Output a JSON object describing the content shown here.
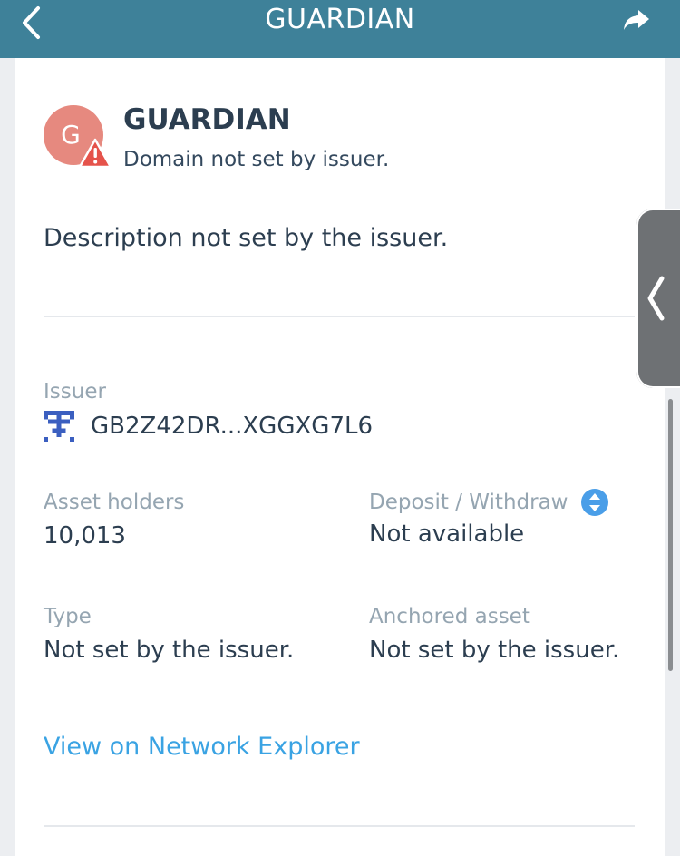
{
  "nav": {
    "title": "GUARDIAN",
    "back_icon": "chevron-left-icon",
    "share_icon": "share-arrow-icon"
  },
  "asset": {
    "avatar_letter": "G",
    "name": "GUARDIAN",
    "domain": "Domain not set by issuer.",
    "description": "Description not set by the issuer."
  },
  "details": {
    "issuer_label": "Issuer",
    "issuer_value": "GB2Z42DR...XGGXG7L6",
    "holders_label": "Asset holders",
    "holders_value": "10,013",
    "deposit_label": "Deposit / Withdraw",
    "deposit_value": "Not available",
    "type_label": "Type",
    "type_value": "Not set by the issuer.",
    "anchored_label": "Anchored asset",
    "anchored_value": "Not set by the issuer."
  },
  "links": {
    "explorer": "View on Network Explorer"
  },
  "colors": {
    "header": "#3e8199",
    "avatar": "#e6897f",
    "warning": "#e5534b",
    "link": "#3aa3e3",
    "identicon": "#3b5fc0",
    "deposit_icon": "#4a9ee8"
  }
}
